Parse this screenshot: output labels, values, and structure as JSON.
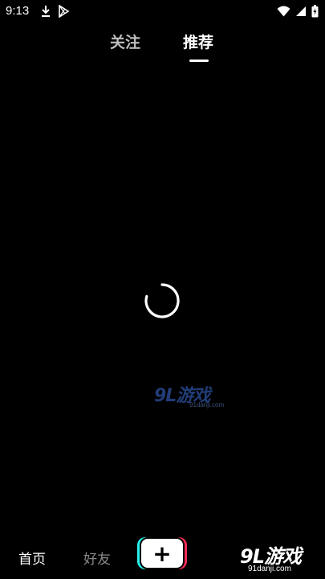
{
  "status_bar": {
    "time": "9:13",
    "left_icons": [
      "download-icon",
      "play-store-icon"
    ],
    "right_icons": [
      "wifi-icon",
      "signal-icon",
      "battery-icon"
    ]
  },
  "top_tabs": {
    "follow": "关注",
    "recommend": "推荐",
    "active": "recommend"
  },
  "content": {
    "loading_indicator": "spinner-icon"
  },
  "watermark_center": {
    "logo_text": "9L游戏",
    "url": "91danji.com"
  },
  "bottom_nav": {
    "home": "首页",
    "friends": "好友",
    "publish_icon": "plus-icon"
  },
  "watermark_corner": {
    "logo_text": "9L游戏",
    "url": "91danji.com"
  },
  "colors": {
    "background": "#000000",
    "active_text": "#ffffff",
    "inactive_text": "#8a8a8a",
    "publish_cyan": "#25f4ee",
    "publish_red": "#fe2c55"
  }
}
